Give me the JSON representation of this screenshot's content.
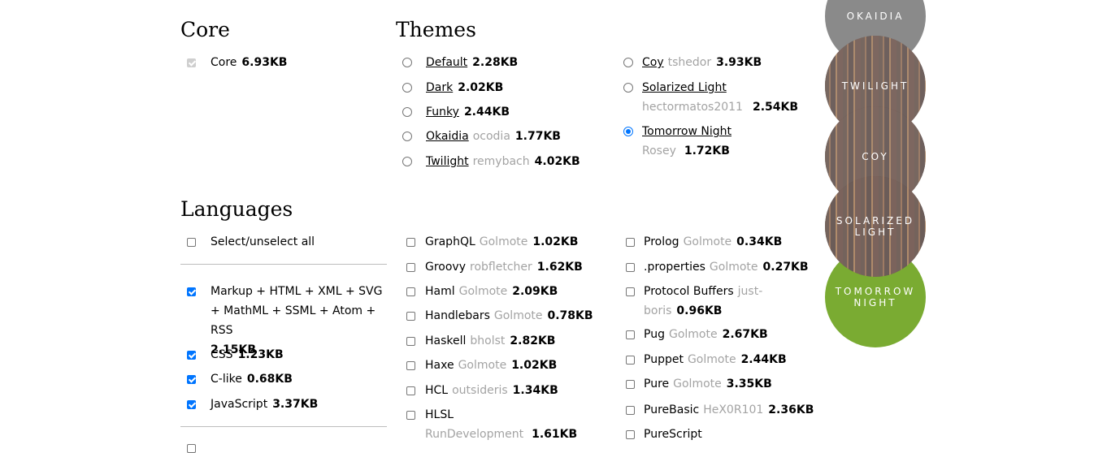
{
  "core": {
    "heading": "Core",
    "items": [
      {
        "name": "Core",
        "size": "6.93KB"
      }
    ]
  },
  "themes": {
    "heading": "Themes",
    "col1": [
      {
        "name": "Default",
        "owner": "",
        "size": "2.28KB"
      },
      {
        "name": "Dark",
        "owner": "",
        "size": "2.02KB"
      },
      {
        "name": "Funky",
        "owner": "",
        "size": "2.44KB"
      },
      {
        "name": "Okaidia",
        "owner": "ocodia",
        "size": "1.77KB"
      },
      {
        "name": "Twilight",
        "owner": "remybach",
        "size": "4.02KB"
      }
    ],
    "col2": [
      {
        "name": "Coy",
        "owner": "tshedor",
        "size": "3.93KB"
      },
      {
        "name": "Solarized Light",
        "owner": "hectormatos2011",
        "size": "2.54KB"
      },
      {
        "name": "Tomorrow Night",
        "owner": "Rosey",
        "size": "1.72KB"
      }
    ],
    "selected": "Tomorrow Night"
  },
  "languages": {
    "heading": "Languages",
    "select_all": "Select/unselect all",
    "col1": [
      {
        "name": "Markup + HTML + XML + SVG + MathML + SSML + Atom + RSS",
        "owner": "",
        "size": "2.15KB",
        "checked": true
      },
      {
        "name": "CSS",
        "owner": "",
        "size": "1.23KB",
        "checked": true
      },
      {
        "name": "C-like",
        "owner": "",
        "size": "0.68KB",
        "checked": true
      },
      {
        "name": "JavaScript",
        "owner": "",
        "size": "3.37KB",
        "checked": true
      }
    ],
    "col2": [
      {
        "name": "GraphQL",
        "owner": "Golmote",
        "size": "1.02KB"
      },
      {
        "name": "Groovy",
        "owner": "robfletcher",
        "size": "1.62KB"
      },
      {
        "name": "Haml",
        "owner": "Golmote",
        "size": "2.09KB"
      },
      {
        "name": "Handlebars",
        "owner": "Golmote",
        "size": "0.78KB"
      },
      {
        "name": "Haskell",
        "owner": "bholst",
        "size": "2.82KB"
      },
      {
        "name": "Haxe",
        "owner": "Golmote",
        "size": "1.02KB"
      },
      {
        "name": "HCL",
        "owner": "outsideris",
        "size": "1.34KB"
      },
      {
        "name": "HLSL",
        "owner": "RunDevelopment",
        "size": "1.61KB"
      }
    ],
    "col3": [
      {
        "name": "Prolog",
        "owner": "Golmote",
        "size": "0.34KB"
      },
      {
        "name": ".properties",
        "owner": "Golmote",
        "size": "0.27KB"
      },
      {
        "name": "Protocol Buffers",
        "owner": "just-boris",
        "size": "0.96KB"
      },
      {
        "name": "Pug",
        "owner": "Golmote",
        "size": "2.67KB"
      },
      {
        "name": "Puppet",
        "owner": "Golmote",
        "size": "2.44KB"
      },
      {
        "name": "Pure",
        "owner": "Golmote",
        "size": "3.35KB"
      },
      {
        "name": "PureBasic",
        "owner": "HeX0R101",
        "size": "2.36KB"
      },
      {
        "name": "PureScript",
        "owner": "",
        "size": ""
      }
    ]
  },
  "theme_circles": [
    {
      "label": "OKAIDIA",
      "bg": "#8a8a8a"
    },
    {
      "label": "TWILIGHT",
      "bg": "#8a8a8a"
    },
    {
      "label": "COY",
      "bg": "#8a8a8a"
    },
    {
      "label": "SOLARIZED LIGHT",
      "bg": "#8a8a8a"
    },
    {
      "label": "TOMORROW NIGHT",
      "bg": "#7aab32"
    }
  ],
  "colors": {
    "accent": "#0075ff",
    "selected_theme": "#7aab32",
    "muted": "#a3a3a3"
  }
}
